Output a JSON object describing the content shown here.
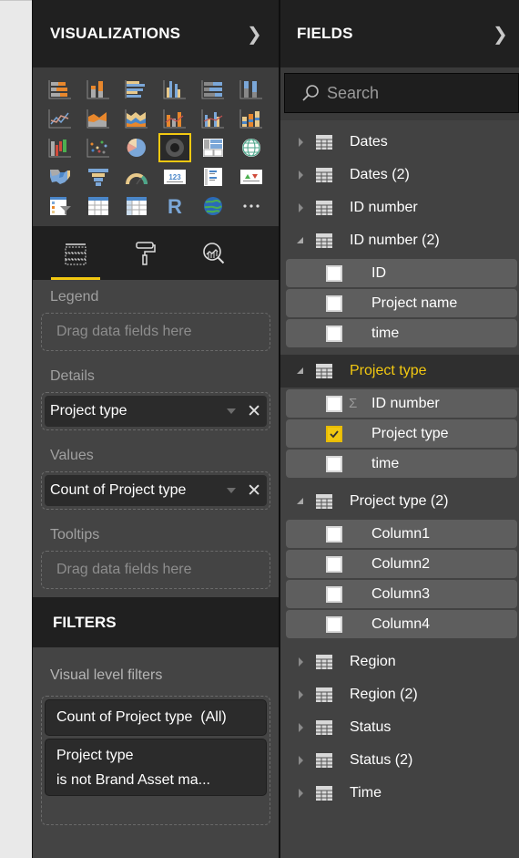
{
  "visualizations": {
    "title": "VISUALIZATIONS",
    "collapse_icon": "chevron-right-icon",
    "gallery": [
      {
        "name": "stacked-bar-chart-icon"
      },
      {
        "name": "stacked-column-chart-icon"
      },
      {
        "name": "clustered-bar-chart-icon"
      },
      {
        "name": "clustered-column-chart-icon"
      },
      {
        "name": "100-percent-stacked-bar-chart-icon"
      },
      {
        "name": "100-percent-stacked-column-chart-icon"
      },
      {
        "name": "line-chart-icon"
      },
      {
        "name": "area-chart-icon"
      },
      {
        "name": "stacked-area-chart-icon"
      },
      {
        "name": "line-and-stacked-column-chart-icon"
      },
      {
        "name": "line-and-clustered-column-chart-icon"
      },
      {
        "name": "ribbon-chart-icon"
      },
      {
        "name": "waterfall-chart-icon"
      },
      {
        "name": "scatter-chart-icon"
      },
      {
        "name": "pie-chart-icon"
      },
      {
        "name": "donut-chart-icon",
        "selected": true
      },
      {
        "name": "treemap-icon"
      },
      {
        "name": "map-icon"
      },
      {
        "name": "filled-map-icon"
      },
      {
        "name": "funnel-icon"
      },
      {
        "name": "gauge-icon"
      },
      {
        "name": "card-icon",
        "text": "123"
      },
      {
        "name": "multi-row-card-icon"
      },
      {
        "name": "kpi-icon"
      },
      {
        "name": "slicer-icon"
      },
      {
        "name": "table-icon"
      },
      {
        "name": "matrix-icon"
      },
      {
        "name": "r-script-visual-icon",
        "text": "R"
      },
      {
        "name": "arcgis-map-icon"
      },
      {
        "name": "more-visuals-icon",
        "text": "···"
      }
    ],
    "tabs": [
      {
        "name": "fields-tab",
        "icon": "fields-well-icon",
        "active": true
      },
      {
        "name": "format-tab",
        "icon": "paint-roller-icon",
        "active": false
      },
      {
        "name": "analytics-tab",
        "icon": "analytics-magnifier-icon",
        "active": false
      }
    ],
    "wells": {
      "legend": {
        "label": "Legend",
        "placeholder": "Drag data fields here"
      },
      "details": {
        "label": "Details",
        "field": "Project type"
      },
      "values": {
        "label": "Values",
        "field": "Count of Project type"
      },
      "tooltips": {
        "label": "Tooltips",
        "placeholder": "Drag data fields here"
      }
    }
  },
  "filters": {
    "title": "FILTERS",
    "visual_level_label": "Visual level filters",
    "cards": [
      {
        "line1": "Count of Project type  (All)"
      },
      {
        "line1": "Project type",
        "line2": "is not Brand Asset ma..."
      }
    ]
  },
  "fields": {
    "title": "FIELDS",
    "collapse_icon": "chevron-right-icon",
    "search_placeholder": "Search",
    "tables": [
      {
        "name": "Dates",
        "expanded": false
      },
      {
        "name": "Dates (2)",
        "expanded": false
      },
      {
        "name": "ID number",
        "expanded": false
      },
      {
        "name": "ID number (2)",
        "expanded": true,
        "fields": [
          {
            "name": "ID",
            "checked": false
          },
          {
            "name": "Project name",
            "checked": false
          },
          {
            "name": "time",
            "checked": false
          }
        ]
      },
      {
        "name": "Project type",
        "expanded": true,
        "highlighted": true,
        "fields": [
          {
            "name": "ID number",
            "checked": false,
            "sigma": "Σ"
          },
          {
            "name": "Project type",
            "checked": true
          },
          {
            "name": "time",
            "checked": false
          }
        ]
      },
      {
        "name": "Project type (2)",
        "expanded": true,
        "fields": [
          {
            "name": "Column1",
            "checked": false
          },
          {
            "name": "Column2",
            "checked": false
          },
          {
            "name": "Column3",
            "checked": false
          },
          {
            "name": "Column4",
            "checked": false
          }
        ]
      },
      {
        "name": "Region",
        "expanded": false
      },
      {
        "name": "Region (2)",
        "expanded": false
      },
      {
        "name": "Status",
        "expanded": false
      },
      {
        "name": "Status (2)",
        "expanded": false
      },
      {
        "name": "Time",
        "expanded": false
      }
    ]
  },
  "colors": {
    "accent": "#f2c811",
    "header_bg": "#202020",
    "pane_bg": "#444444"
  }
}
